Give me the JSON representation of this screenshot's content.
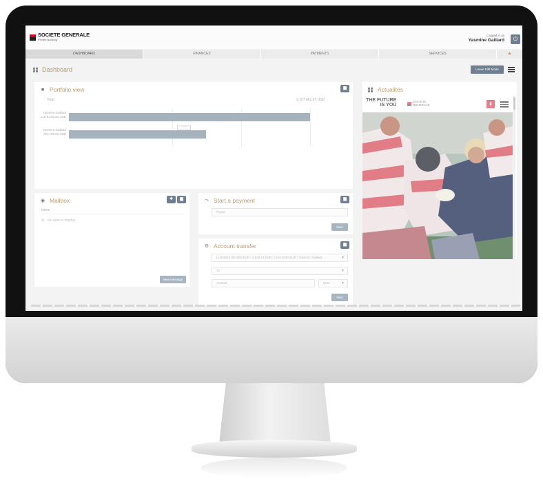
{
  "brand": {
    "name": "SOCIETE GENERALE",
    "subtitle": "Private Banking"
  },
  "user": {
    "logged_label": "Logged in as",
    "name": "Yasmine Gaillard"
  },
  "nav": {
    "tabs": [
      {
        "label": "DASHBOARD",
        "active": true
      },
      {
        "label": "FINANCES",
        "active": false
      },
      {
        "label": "PAYMENTS",
        "active": false
      },
      {
        "label": "SERVICES",
        "active": false
      }
    ]
  },
  "page": {
    "title": "Dashboard",
    "edit_button": "Leave Edit Mode"
  },
  "portfolio": {
    "title": "Portfolio view",
    "total_label": "Total",
    "total_value": "2,157,461.57 USD",
    "rows": [
      {
        "owner": "Yasmine Gaillard",
        "amount": "1,376,263.91 USD",
        "value": 1376263.91
      },
      {
        "owner": "Yasmine Gaillard",
        "amount": "781,199.62 USD",
        "value": 781199.62
      }
    ]
  },
  "mailbox": {
    "title": "Mailbox",
    "folder": "Inbox",
    "empty_text": "No data to display",
    "new_message_button": "New message"
  },
  "start_payment": {
    "title": "Start a payment",
    "input_placeholder": "Payee",
    "next_button": "Next"
  },
  "account_transfer": {
    "title": "Account transfer",
    "from_value": "LU115216-001203-EUR / 2,615.13 EUR / CAN-2200-EUR / Yasmine Gaillard",
    "to_placeholder": "To",
    "amount_placeholder": "Amount",
    "currency": "EUR",
    "next_button": "Next"
  },
  "actualites": {
    "title": "Actualités",
    "banner_line1": "THE FUTURE",
    "banner_line2": "IS YOU",
    "banner_brand_line1": "SOCIETE",
    "banner_brand_line2": "GENERALE"
  },
  "colors": {
    "brand_red": "#d6001c",
    "accent_gold": "#b79a6d",
    "button_slate": "#6f7f8f",
    "bar_fill": "#a6b3bd"
  }
}
